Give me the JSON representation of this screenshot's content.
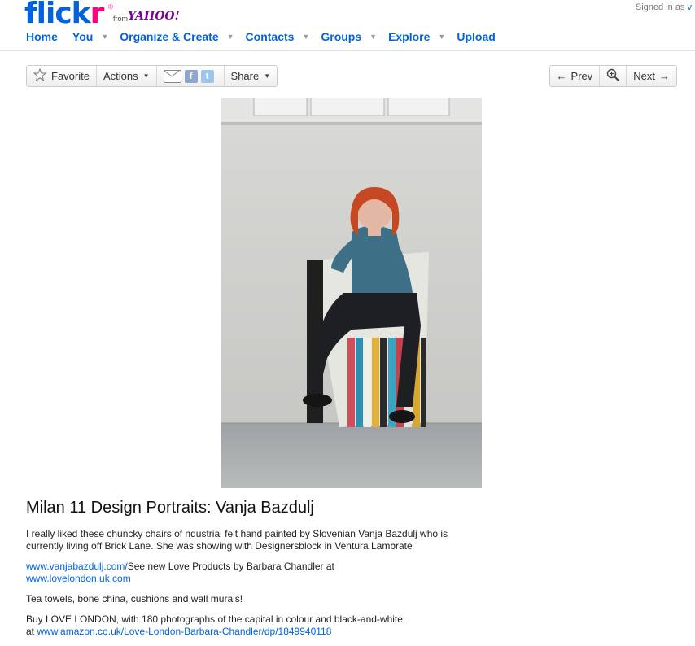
{
  "header": {
    "logo_text_fl": "flick",
    "logo_text_r": "r",
    "logo_from": "from",
    "logo_yahoo": "YAHOO!",
    "logo_reg": "®",
    "signed_in": "Signed in as",
    "signed_in_user": "v"
  },
  "nav": {
    "items": [
      {
        "label": "Home"
      },
      {
        "label": "You"
      },
      {
        "label": "Organize & Create"
      },
      {
        "label": "Contacts"
      },
      {
        "label": "Groups"
      },
      {
        "label": "Explore"
      },
      {
        "label": "Upload"
      }
    ]
  },
  "toolbar": {
    "favorite": "Favorite",
    "actions": "Actions",
    "share": "Share",
    "facebook_glyph": "f",
    "twitter_glyph": "t"
  },
  "pager": {
    "prev": "Prev",
    "next": "Next"
  },
  "photo": {
    "title": "Milan 11 Design Portraits: Vanja Bazdulj"
  },
  "description": {
    "p1": "I really liked these chuncky chairs of ndustrial felt hand painted by Slovenian Vanja Bazdulj who is currently living off Brick Lane. She was showing with Designersblock in Ventura Lambrate",
    "link1": "www.vanjabazdulj.com/",
    "p2_text": "See new Love Products by Barbara Chandler at",
    "link2": "www.lovelondon.uk.com",
    "p3": "Tea towels, bone china, cushions and wall murals!",
    "p4_text": "Buy LOVE LONDON, with 180 photographs of the capital in colour and black-and-white,",
    "p4_at": "at",
    "link3": "www.amazon.co.uk/Love-London-Barbara-Chandler/dp/1849940118"
  },
  "icons": {
    "star": "star-icon",
    "mail": "mail-icon",
    "facebook": "facebook-icon",
    "twitter": "twitter-icon",
    "prev_arrow": "arrow-left-icon",
    "zoom": "zoom-icon",
    "next_arrow": "arrow-right-icon"
  },
  "colors": {
    "link_blue": "#0063dc",
    "flickr_pink": "#ff0084",
    "yahoo_purple": "#7b0099"
  }
}
